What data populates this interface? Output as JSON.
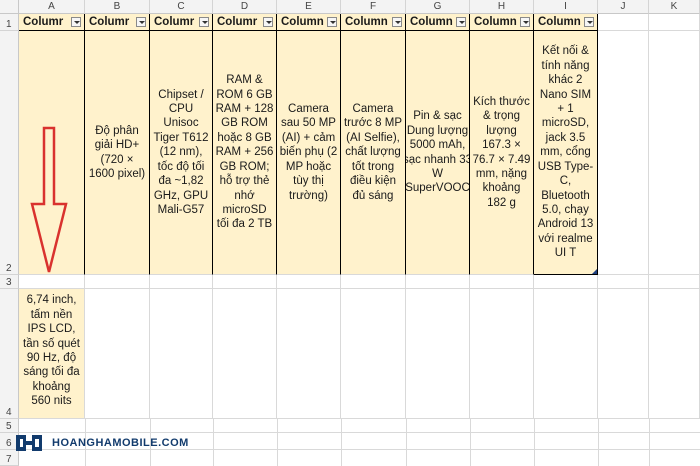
{
  "column_letters": [
    "A",
    "B",
    "C",
    "D",
    "E",
    "F",
    "G",
    "H",
    "I",
    "J",
    "K"
  ],
  "row_numbers": [
    "1",
    "2",
    "3",
    "4",
    "5",
    "6",
    "7"
  ],
  "header_label": "Column",
  "header_labels_shown": [
    "Columr",
    "Columr",
    "Columr",
    "Columr",
    "Column",
    "Column",
    "Column",
    "Column",
    "Column"
  ],
  "row2": {
    "B": "Độ phân giải HD+ (720 × 1600 pixel)",
    "C": "Chipset / CPU Unisoc Tiger T612 (12 nm), tốc độ tối đa ~1,82 GHz, GPU Mali-G57",
    "D": "RAM & ROM 6 GB RAM + 128 GB ROM hoặc 8 GB RAM + 256 GB ROM; hỗ trợ thẻ nhớ microSD tối đa 2 TB",
    "E": "Camera sau 50 MP (AI) + cảm biến phụ (2 MP hoặc tùy thị trường)",
    "F": "Camera trước 8 MP (AI Selfie), chất lượng tốt trong điều kiện đủ sáng",
    "G": "Pin & sạc Dung lượng 5000 mAh, sạc nhanh 33 W (SuperVOOC)",
    "H": "Kích thước & trọng lượng 167.3 × 76.7 × 7.49 mm, nặng khoảng 182 g",
    "I": "Kết nối & tính năng khác 2 Nano SIM + 1 microSD, jack 3.5 mm, cổng USB Type-C, Bluetooth 5.0, chạy Android 13 với realme UI T"
  },
  "row4": {
    "A": "Màn hình 6,74 inch, tấm nền IPS LCD, tần số quét 90 Hz, độ sáng tối đa khoảng 560 nits"
  },
  "icons": [
    "arrow-down-icon",
    "dropdown-icon",
    "logo-icon"
  ],
  "colors": {
    "yellow_fill": "#fff2cc",
    "arrow": "#d9322e",
    "logo_blue": "#123b6d"
  },
  "watermark": "HOANGHAMOBILE.COM"
}
